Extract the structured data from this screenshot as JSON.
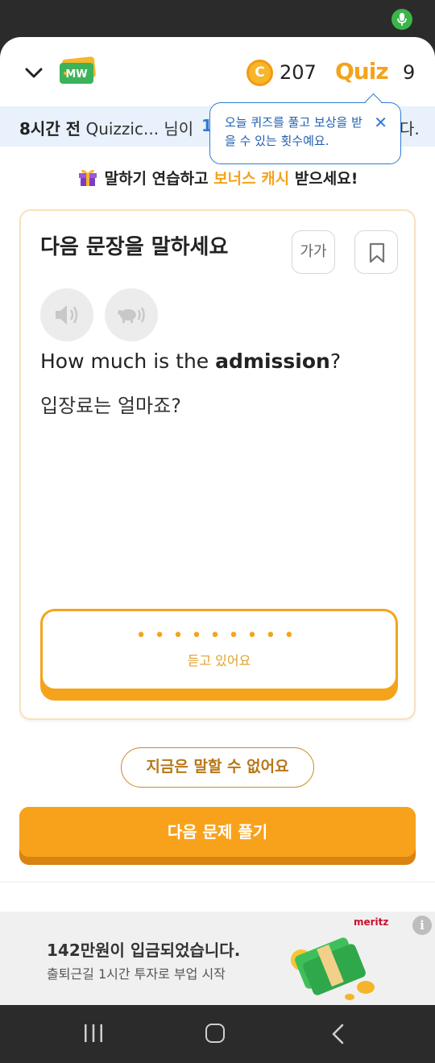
{
  "header": {
    "coins": "207",
    "quiz_logo": "Quiz",
    "quiz_count": "9",
    "coin_symbol": "C",
    "brand_logo": "MW"
  },
  "ticker": {
    "prefix_bold": "8시간 전",
    "text": " Quizzic... 님이",
    "number": "1",
    "tail": "다."
  },
  "tooltip": {
    "text": "오늘 퀴즈를 풀고 보상을 받을 수 있는 횟수예요.",
    "close": "✕"
  },
  "promo": {
    "before": "말하기 연습하고 ",
    "highlight": "보너스 캐시",
    "after": " 받으세요!"
  },
  "card": {
    "title": "다음 문장을 말하세요",
    "font_size_label": "가가",
    "sentence_en_before": "How much is the ",
    "sentence_en_bold": "admission",
    "sentence_en_after": "?",
    "sentence_ko": "입장료는 얼마죠?",
    "listening_dots": "•••••••••",
    "listening_label": "듣고 있어요"
  },
  "buttons": {
    "cant_speak": "지금은 말할 수 없어요",
    "next": "다음 문제 풀기"
  },
  "ad": {
    "title": "142만원이 입금되었습니다.",
    "subtitle": "출퇴근길 1시간 투자로 부업 시작",
    "brand": "meritz",
    "info": "i"
  },
  "colors": {
    "accent": "#f8a21b",
    "blue": "#2e7ad6"
  }
}
